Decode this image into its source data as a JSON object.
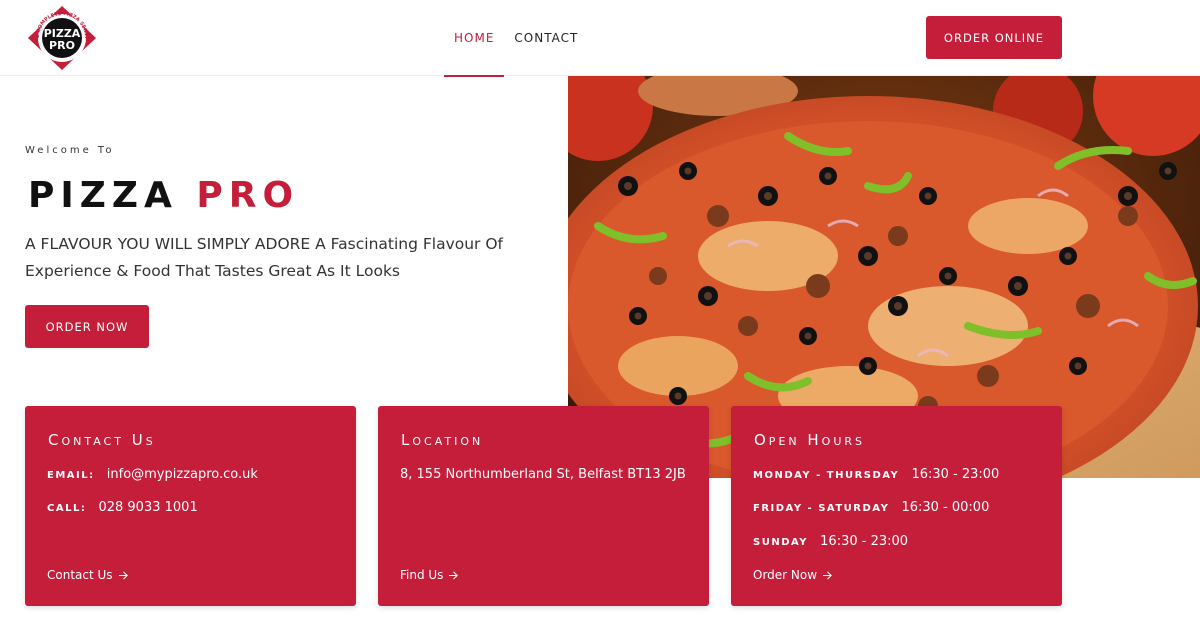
{
  "header": {
    "logo": {
      "ring_text": "THE COMPLETE PIZZA SERVICE",
      "line1": "PIZZA",
      "line2": "PRO"
    },
    "nav": [
      {
        "label": "HOME",
        "active": true
      },
      {
        "label": "CONTACT",
        "active": false
      }
    ],
    "cta_label": "ORDER ONLINE"
  },
  "hero": {
    "welcome": "Welcome To",
    "brand_part1": "PIZZA",
    "brand_part2": "PRO",
    "tagline": "A FLAVOUR YOU WILL SIMPLY ADORE A Fascinating Flavour Of Experience & Food That Tastes Great As It Looks",
    "cta_label": "ORDER NOW",
    "image": "pizza-photo"
  },
  "cards": [
    {
      "title": "Contact Us",
      "rows": [
        {
          "label": "Email:",
          "value": "info@mypizzapro.co.uk"
        },
        {
          "label": "call:",
          "value": "028 9033 1001"
        }
      ],
      "link": "Contact Us"
    },
    {
      "title": "Location",
      "rows": [
        {
          "label": "",
          "value": "8, 155 Northumberland St, Belfast BT13 2JB"
        }
      ],
      "link": "Find Us"
    },
    {
      "title": "Open Hours",
      "rows": [
        {
          "label": "Monday - Thursday",
          "value": "16:30 - 23:00"
        },
        {
          "label": "Friday - Saturday",
          "value": "16:30 - 00:00"
        },
        {
          "label": "Sunday",
          "value": "16:30 - 23:00"
        }
      ],
      "link": "Order Now"
    }
  ],
  "colors": {
    "accent": "#c41e3a",
    "text": "#222222",
    "background": "#ffffff"
  },
  "icons": [
    "logo-badge",
    "arrow-right-icon"
  ]
}
